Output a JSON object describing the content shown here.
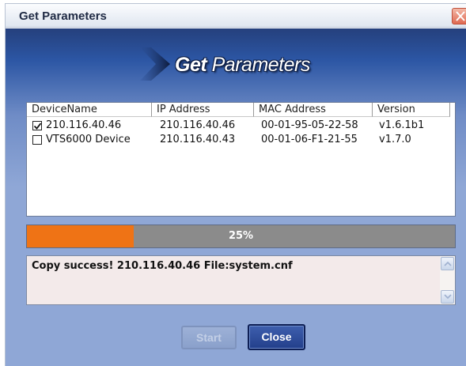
{
  "window": {
    "title": "Get Parameters"
  },
  "banner": {
    "word1": "Get",
    "word2": " Parameters"
  },
  "table": {
    "columns": [
      "DeviceName",
      "IP Address",
      "MAC Address",
      "Version"
    ],
    "rows": [
      {
        "checked": true,
        "name": "210.116.40.46",
        "ip": "210.116.40.46",
        "mac": "00-01-95-05-22-58",
        "version": "v1.6.1b1"
      },
      {
        "checked": false,
        "name": "VTS6000 Device",
        "ip": "210.116.40.43",
        "mac": "00-01-06-F1-21-55",
        "version": "v1.7.0"
      }
    ]
  },
  "progress": {
    "percent": 25,
    "label": "25%",
    "fill_color": "#ef7315",
    "track_color": "#8b8b8b"
  },
  "log": {
    "message": "Copy success! 210.116.40.46   File:system.cnf"
  },
  "buttons": {
    "start": "Start",
    "close": "Close"
  },
  "colors": {
    "banner_dark": "#25407d",
    "panel": "#8fa7d6"
  }
}
